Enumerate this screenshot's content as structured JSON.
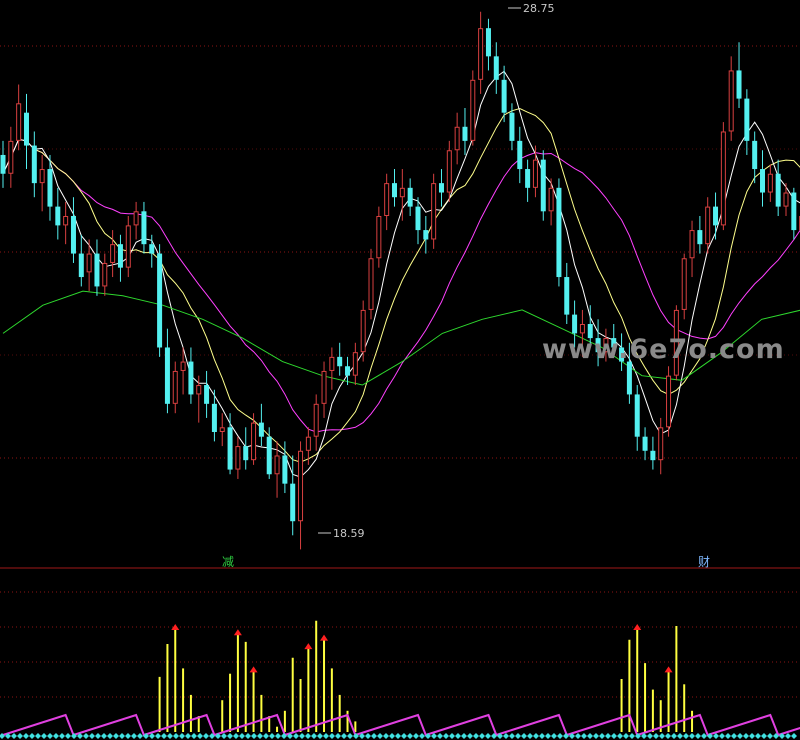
{
  "watermark": "www.6e7o.com",
  "markers": {
    "high": "28.75",
    "low": "18.59"
  },
  "signals": [
    {
      "text": "减",
      "color": "#2ecc40"
    },
    {
      "text": "财",
      "color": "#7fb8ff"
    }
  ],
  "colors": {
    "up": "#d84040",
    "down": "#54f0f0",
    "ma5": "#ffffff",
    "ma10": "#ffff8c",
    "ma20": "#ff40ff",
    "ma60": "#2ed82e",
    "grid": "#8b1414",
    "bar": "#ffff40",
    "arrow": "#ff2020",
    "wave": "#e040e0",
    "diamond": "#40e0e0"
  },
  "chart_data": [
    {
      "type": "candlestick",
      "title": "",
      "ylim": [
        17.5,
        29.0
      ],
      "annotations": [
        {
          "text": "28.75",
          "kind": "high"
        },
        {
          "text": "18.59",
          "kind": "low"
        }
      ],
      "series": [
        {
          "name": "",
          "role": "price",
          "ohlc": [
            [
              25.7,
              26.0,
              25.0,
              25.3
            ],
            [
              25.3,
              26.3,
              25.0,
              26.0
            ],
            [
              26.0,
              27.2,
              25.8,
              26.8
            ],
            [
              26.6,
              27.0,
              25.4,
              25.9
            ],
            [
              25.9,
              26.2,
              24.8,
              25.1
            ],
            [
              25.1,
              25.7,
              24.5,
              25.4
            ],
            [
              25.4,
              25.7,
              24.3,
              24.6
            ],
            [
              24.6,
              25.0,
              23.9,
              24.2
            ],
            [
              24.2,
              24.7,
              23.8,
              24.4
            ],
            [
              24.4,
              24.8,
              23.4,
              23.6
            ],
            [
              23.6,
              24.0,
              22.9,
              23.1
            ],
            [
              23.2,
              23.9,
              22.8,
              23.6
            ],
            [
              23.6,
              23.9,
              22.7,
              22.9
            ],
            [
              22.9,
              23.6,
              22.7,
              23.4
            ],
            [
              23.4,
              24.1,
              23.1,
              23.8
            ],
            [
              23.8,
              24.0,
              23.0,
              23.3
            ],
            [
              23.3,
              24.4,
              23.1,
              24.2
            ],
            [
              24.2,
              24.7,
              23.9,
              24.5
            ],
            [
              24.5,
              24.7,
              23.6,
              23.8
            ],
            [
              23.8,
              24.0,
              23.3,
              23.6
            ],
            [
              23.6,
              23.8,
              21.4,
              21.6
            ],
            [
              21.6,
              22.0,
              20.2,
              20.4
            ],
            [
              20.4,
              21.3,
              20.2,
              21.1
            ],
            [
              21.1,
              21.6,
              20.6,
              21.3
            ],
            [
              21.3,
              21.6,
              20.4,
              20.6
            ],
            [
              20.6,
              21.0,
              20.0,
              20.8
            ],
            [
              20.8,
              21.1,
              20.1,
              20.4
            ],
            [
              20.4,
              20.7,
              19.6,
              19.8
            ],
            [
              19.8,
              20.2,
              19.5,
              19.9
            ],
            [
              19.9,
              20.2,
              18.9,
              19.0
            ],
            [
              19.0,
              19.7,
              18.8,
              19.5
            ],
            [
              19.5,
              19.9,
              19.0,
              19.2
            ],
            [
              19.2,
              20.2,
              19.1,
              20.0
            ],
            [
              20.0,
              20.4,
              19.5,
              19.7
            ],
            [
              19.7,
              19.9,
              18.8,
              18.9
            ],
            [
              18.9,
              19.6,
              18.4,
              19.3
            ],
            [
              19.3,
              19.6,
              18.5,
              18.7
            ],
            [
              18.7,
              19.3,
              17.6,
              17.9
            ],
            [
              17.9,
              19.6,
              17.3,
              19.4
            ],
            [
              19.4,
              19.9,
              19.1,
              19.7
            ],
            [
              19.7,
              20.6,
              19.4,
              20.4
            ],
            [
              20.4,
              21.3,
              20.1,
              21.1
            ],
            [
              21.1,
              21.6,
              20.7,
              21.4
            ],
            [
              21.4,
              21.7,
              21.0,
              21.2
            ],
            [
              21.2,
              21.4,
              20.8,
              21.0
            ],
            [
              21.0,
              21.7,
              20.8,
              21.5
            ],
            [
              21.5,
              22.6,
              21.3,
              22.4
            ],
            [
              22.4,
              23.7,
              22.2,
              23.5
            ],
            [
              23.5,
              24.6,
              23.3,
              24.4
            ],
            [
              24.4,
              25.3,
              24.1,
              25.1
            ],
            [
              25.1,
              25.4,
              24.6,
              24.8
            ],
            [
              24.8,
              25.4,
              24.3,
              25.0
            ],
            [
              25.0,
              25.2,
              24.4,
              24.6
            ],
            [
              24.6,
              24.8,
              23.8,
              24.1
            ],
            [
              24.1,
              24.4,
              23.6,
              23.9
            ],
            [
              23.9,
              25.3,
              23.7,
              25.1
            ],
            [
              25.1,
              25.4,
              24.6,
              24.9
            ],
            [
              24.9,
              26.0,
              24.7,
              25.8
            ],
            [
              25.8,
              26.6,
              25.5,
              26.3
            ],
            [
              26.3,
              26.7,
              25.7,
              26.0
            ],
            [
              26.0,
              27.5,
              25.9,
              27.3
            ],
            [
              27.3,
              28.75,
              27.0,
              28.4
            ],
            [
              28.4,
              28.6,
              27.5,
              27.8
            ],
            [
              27.8,
              28.1,
              27.0,
              27.3
            ],
            [
              27.3,
              27.6,
              26.4,
              26.6
            ],
            [
              26.6,
              26.8,
              25.8,
              26.0
            ],
            [
              26.0,
              26.3,
              25.1,
              25.4
            ],
            [
              25.4,
              25.6,
              24.7,
              25.0
            ],
            [
              25.0,
              25.9,
              24.8,
              25.6
            ],
            [
              25.6,
              25.8,
              24.3,
              24.5
            ],
            [
              24.5,
              25.2,
              24.2,
              25.0
            ],
            [
              25.0,
              25.2,
              22.9,
              23.1
            ],
            [
              23.1,
              23.4,
              22.1,
              22.3
            ],
            [
              22.3,
              22.6,
              21.6,
              21.9
            ],
            [
              21.9,
              22.4,
              21.4,
              22.1
            ],
            [
              22.1,
              22.5,
              21.6,
              21.8
            ],
            [
              21.8,
              22.2,
              21.2,
              21.5
            ],
            [
              21.5,
              22.0,
              21.3,
              21.8
            ],
            [
              21.8,
              22.1,
              21.4,
              21.6
            ],
            [
              21.6,
              21.9,
              21.1,
              21.3
            ],
            [
              21.3,
              21.7,
              20.4,
              20.6
            ],
            [
              20.6,
              20.8,
              19.4,
              19.7
            ],
            [
              19.7,
              19.9,
              19.2,
              19.4
            ],
            [
              19.4,
              19.7,
              19.0,
              19.2
            ],
            [
              19.2,
              20.1,
              18.9,
              19.9
            ],
            [
              19.9,
              21.2,
              19.7,
              21.0
            ],
            [
              21.0,
              22.5,
              20.9,
              22.4
            ],
            [
              22.4,
              23.6,
              22.2,
              23.5
            ],
            [
              23.5,
              24.3,
              23.1,
              24.1
            ],
            [
              24.1,
              24.4,
              23.6,
              23.8
            ],
            [
              23.8,
              24.8,
              23.6,
              24.6
            ],
            [
              24.6,
              24.9,
              23.9,
              24.2
            ],
            [
              24.2,
              26.4,
              24.1,
              26.2
            ],
            [
              26.2,
              27.8,
              26.0,
              27.5
            ],
            [
              27.5,
              28.1,
              26.7,
              26.9
            ],
            [
              26.9,
              27.1,
              25.7,
              26.0
            ],
            [
              26.0,
              26.2,
              25.1,
              25.4
            ],
            [
              25.4,
              25.8,
              24.6,
              24.9
            ],
            [
              24.9,
              25.5,
              24.7,
              25.3
            ],
            [
              25.3,
              25.6,
              24.4,
              24.6
            ],
            [
              24.6,
              25.1,
              24.4,
              24.9
            ],
            [
              24.9,
              25.0,
              23.9,
              24.1
            ],
            [
              24.1,
              24.6,
              23.6,
              24.4
            ]
          ]
        },
        {
          "name": "",
          "role": "ma5"
        },
        {
          "name": "",
          "role": "ma10"
        },
        {
          "name": "",
          "role": "ma20"
        },
        {
          "name": "",
          "role": "ma60",
          "values": [
            21.9,
            22.5,
            22.8,
            22.7,
            22.5,
            22.2,
            21.8,
            21.3,
            21.0,
            20.8,
            21.3,
            21.9,
            22.2,
            22.4,
            22.0,
            21.6,
            21.0,
            20.9,
            21.5,
            22.2,
            22.4
          ]
        }
      ]
    },
    {
      "type": "bar",
      "title": "",
      "ylim": [
        0,
        1
      ],
      "series": [
        {
          "name": "",
          "role": "signal",
          "values": [
            0,
            0,
            0,
            0,
            0,
            0,
            0,
            0,
            0,
            0,
            0,
            0,
            0,
            0,
            0,
            0,
            0,
            0,
            0,
            0,
            0.52,
            0.83,
            1.0,
            0.6,
            0.35,
            0.15,
            0,
            0,
            0.3,
            0.55,
            0.95,
            0.85,
            0.6,
            0.35,
            0.15,
            0.05,
            0.2,
            0.7,
            0.5,
            0.82,
            1.05,
            0.9,
            0.6,
            0.35,
            0.2,
            0.1,
            0,
            0,
            0,
            0,
            0,
            0,
            0,
            0,
            0,
            0,
            0,
            0,
            0,
            0,
            0,
            0,
            0,
            0,
            0,
            0,
            0,
            0,
            0,
            0,
            0,
            0,
            0,
            0,
            0,
            0,
            0,
            0,
            0,
            0.5,
            0.87,
            1.0,
            0.65,
            0.4,
            0.3,
            0.6,
            1.0,
            0.45,
            0.2,
            0,
            0,
            0,
            0,
            0,
            0,
            0,
            0,
            0,
            0,
            0
          ]
        }
      ],
      "arrows": [
        22,
        30,
        32,
        39,
        41,
        81,
        85
      ]
    }
  ]
}
